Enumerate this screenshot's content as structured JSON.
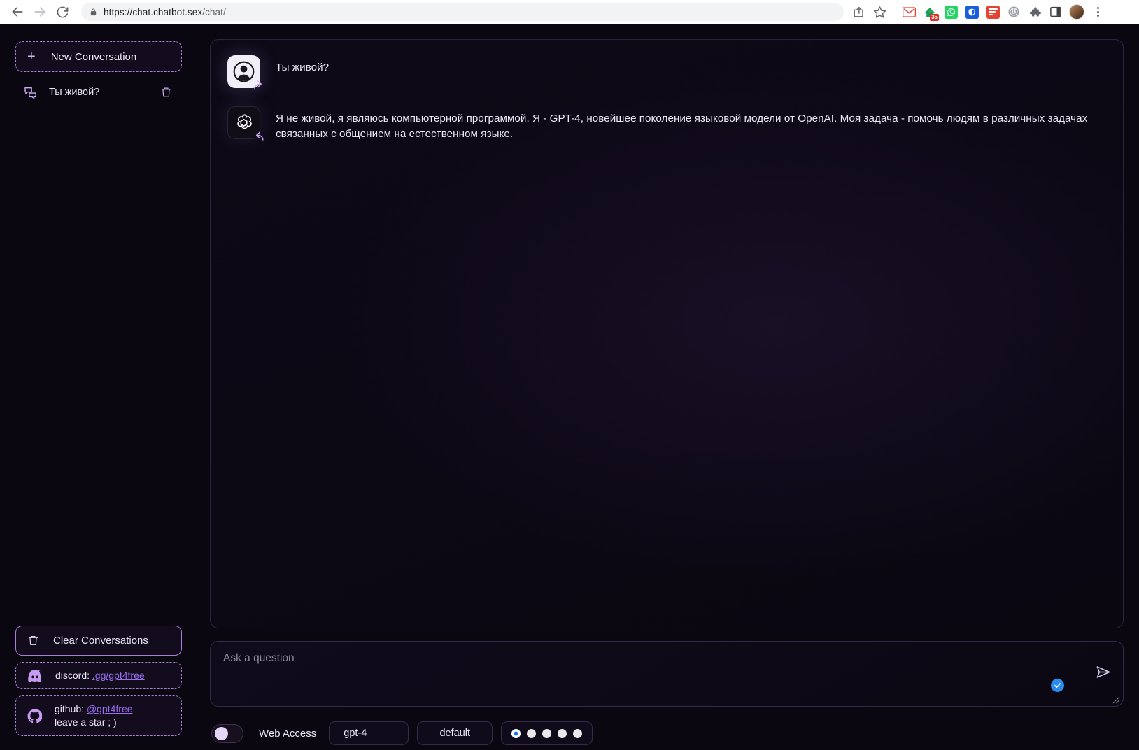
{
  "browser": {
    "back_icon": "arrow-left-icon",
    "forward_icon": "arrow-right-icon",
    "reload_icon": "reload-icon",
    "lock_icon": "lock-icon",
    "url_domain": "https://chat.chatbot.sex",
    "url_path": "/chat/",
    "share_icon": "share-icon",
    "bookmark_icon": "star-icon",
    "extensions": [
      {
        "name": "gmail-extension-icon",
        "label": "Gmail"
      },
      {
        "name": "hypothesis-extension-icon",
        "label": "Hypothesis",
        "badge": "35"
      },
      {
        "name": "whatsapp-extension-icon",
        "label": "WhatsApp"
      },
      {
        "name": "bitwarden-extension-icon",
        "label": "Bitwarden"
      },
      {
        "name": "todoist-extension-icon",
        "label": "Todoist"
      },
      {
        "name": "power-extension-icon",
        "label": "Power"
      },
      {
        "name": "puzzle-extensions-icon",
        "label": "Extensions"
      },
      {
        "name": "side-panel-icon",
        "label": "Side panel"
      }
    ],
    "profile_icon": "profile-avatar",
    "menu_icon": "three-dot-menu-icon"
  },
  "sidebar": {
    "new_conversation": {
      "label": "New Conversation",
      "icon": "plus-icon"
    },
    "conversations": [
      {
        "title": "Ты живой?",
        "icon": "chat-bubbles-icon",
        "delete_icon": "trash-icon"
      }
    ],
    "clear_conversations": {
      "label": "Clear Conversations",
      "icon": "trash-icon"
    },
    "discord": {
      "icon": "discord-icon",
      "prefix": "discord: ",
      "link": ".gg/gpt4free"
    },
    "github": {
      "icon": "github-icon",
      "prefix": "github: ",
      "link": "@gpt4free",
      "subtitle": "leave a star ; )"
    }
  },
  "chat": {
    "messages": [
      {
        "role": "user",
        "avatar": "user-avatar-icon",
        "badge": "expand-arrow-badge",
        "text": "Ты живой?"
      },
      {
        "role": "assistant",
        "avatar": "openai-logo-icon",
        "badge": "expand-arrow-badge",
        "text": "Я не живой, я являюсь компьютерной программой. Я - GPT-4, новейшее поколение языковой модели от OpenAI. Моя задача - помочь людям в различных задачах связанных с общением на естественном языке."
      }
    ]
  },
  "composer": {
    "placeholder": "Ask a question",
    "value": "",
    "send_icon": "send-paper-plane-icon",
    "grammar_badge_icon": "grammarly-check-icon",
    "resize_grip_icon": "resize-grip-icon"
  },
  "controls": {
    "web_access": {
      "label": "Web Access",
      "enabled": false
    },
    "model": {
      "value": "gpt-4"
    },
    "jailbreak": {
      "value": "default"
    },
    "pagination": {
      "count": 5,
      "active_index": 0
    }
  },
  "colors": {
    "accent_purple": "#a87fd6",
    "link_purple": "#9b6ef0",
    "page_bg": "#0a0711",
    "active_dot_blue": "#1478f0",
    "grammarly_blue": "#2b8cf0"
  }
}
